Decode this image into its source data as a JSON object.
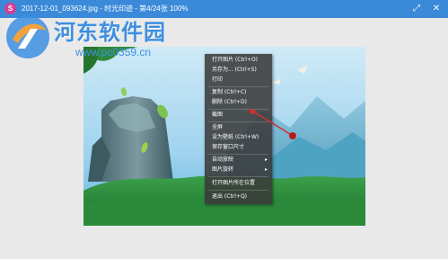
{
  "window": {
    "title": "2017-12-01_093624.jpg - 时光印迹 - 第4/24张 100%",
    "app_icon_letter": "S",
    "min_glyph": "⤢",
    "close_glyph": "✕"
  },
  "watermark": {
    "title": "河东软件园",
    "url": "www.pc0359.cn"
  },
  "context_menu": {
    "items": [
      {
        "label": "打开图片   (Ctrl+O)"
      },
      {
        "label": "另存为...  (Ctrl+S)"
      },
      {
        "label": "打印"
      },
      {
        "label": "复制   (Ctrl+C)"
      },
      {
        "label": "删除   (Ctrl+D)"
      },
      {
        "label": "截图"
      },
      {
        "label": "全屏"
      },
      {
        "label": "设为壁纸   (Ctrl+W)"
      },
      {
        "label": "保存窗口尺寸"
      },
      {
        "label": "自动放映",
        "submenu": true
      },
      {
        "label": "图片旋转",
        "submenu": true
      },
      {
        "label": "打开图片所在位置"
      },
      {
        "label": "退出   (Ctrl+Q)"
      }
    ],
    "submenu_glyph": "▸"
  },
  "colors": {
    "titlebar": "#3b8ad9",
    "menu_bg": "#3a3a3a",
    "annotation_arrow": "#d32f2f"
  }
}
